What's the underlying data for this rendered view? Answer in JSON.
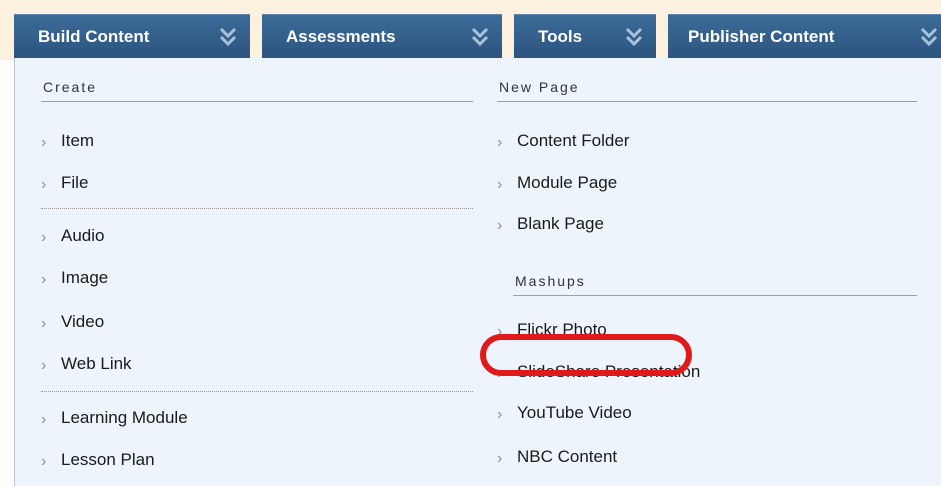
{
  "tabs": [
    {
      "label": "Build Content"
    },
    {
      "label": "Assessments"
    },
    {
      "label": "Tools"
    },
    {
      "label": "Publisher Content"
    }
  ],
  "menu": {
    "create": {
      "header": "Create",
      "group1": [
        "Item",
        "File"
      ],
      "group2": [
        "Audio",
        "Image",
        "Video",
        "Web Link"
      ],
      "group3": [
        "Learning Module",
        "Lesson Plan"
      ]
    },
    "new_page": {
      "header": "New Page",
      "items": [
        "Content Folder",
        "Module Page",
        "Blank Page"
      ]
    },
    "mashups": {
      "header": "Mashups",
      "items": [
        "Flickr Photo",
        "SlideShare Presentation",
        "YouTube Video",
        "NBC Content"
      ]
    }
  },
  "colors": {
    "tab_bg": "#2f5983",
    "menu_bg": "#eef4fc",
    "highlight": "#e01a1a"
  },
  "icons": {
    "tab_expand": "double-chevron-down-icon",
    "item_bullet": "chevron-right-icon"
  }
}
